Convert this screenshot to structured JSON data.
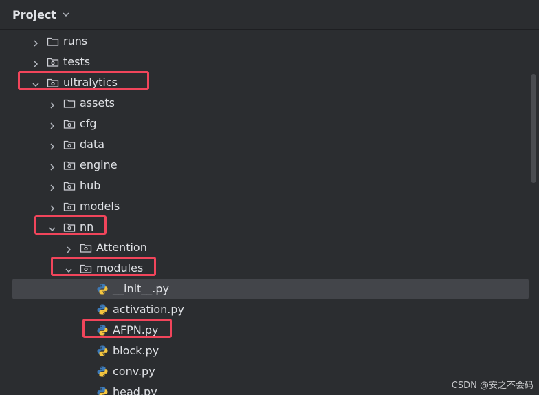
{
  "header": {
    "title": "Project"
  },
  "tree": [
    {
      "label": "runs",
      "kind": "folder",
      "depth": 0,
      "expanded": false,
      "icon": "folder-icon"
    },
    {
      "label": "tests",
      "kind": "package",
      "depth": 0,
      "expanded": false,
      "icon": "package-folder-icon"
    },
    {
      "label": "ultralytics",
      "kind": "package",
      "depth": 0,
      "expanded": true,
      "icon": "package-folder-icon",
      "highlighted": true
    },
    {
      "label": "assets",
      "kind": "folder",
      "depth": 1,
      "expanded": false,
      "icon": "folder-icon"
    },
    {
      "label": "cfg",
      "kind": "package",
      "depth": 1,
      "expanded": false,
      "icon": "package-folder-icon"
    },
    {
      "label": "data",
      "kind": "package",
      "depth": 1,
      "expanded": false,
      "icon": "package-folder-icon"
    },
    {
      "label": "engine",
      "kind": "package",
      "depth": 1,
      "expanded": false,
      "icon": "package-folder-icon"
    },
    {
      "label": "hub",
      "kind": "package",
      "depth": 1,
      "expanded": false,
      "icon": "package-folder-icon"
    },
    {
      "label": "models",
      "kind": "package",
      "depth": 1,
      "expanded": false,
      "icon": "package-folder-icon"
    },
    {
      "label": "nn",
      "kind": "package",
      "depth": 1,
      "expanded": true,
      "icon": "package-folder-icon",
      "highlighted": true
    },
    {
      "label": "Attention",
      "kind": "package",
      "depth": 2,
      "expanded": false,
      "icon": "package-folder-icon"
    },
    {
      "label": "modules",
      "kind": "package",
      "depth": 2,
      "expanded": true,
      "icon": "package-folder-icon",
      "highlighted": true
    },
    {
      "label": "__init__.py",
      "kind": "file",
      "depth": 3,
      "icon": "python-file-icon",
      "selected": true
    },
    {
      "label": "activation.py",
      "kind": "file",
      "depth": 3,
      "icon": "python-file-icon"
    },
    {
      "label": "AFPN.py",
      "kind": "file",
      "depth": 3,
      "icon": "python-file-icon",
      "highlighted": true
    },
    {
      "label": "block.py",
      "kind": "file",
      "depth": 3,
      "icon": "python-file-icon"
    },
    {
      "label": "conv.py",
      "kind": "file",
      "depth": 3,
      "icon": "python-file-icon"
    },
    {
      "label": "head.py",
      "kind": "file",
      "depth": 3,
      "icon": "python-file-icon"
    }
  ],
  "watermark": "CSDN @安之不会码",
  "colors": {
    "background": "#2b2d30",
    "selection": "#43454a",
    "highlight_box": "#f1455b",
    "text": "#dfe1e5"
  }
}
